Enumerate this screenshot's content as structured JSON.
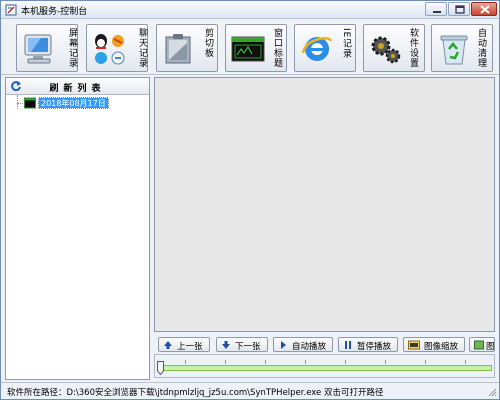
{
  "window": {
    "title": "本机服务-控制台"
  },
  "toolbar": {
    "buttons": [
      {
        "label": "屏幕记录",
        "icon": "monitor-icon"
      },
      {
        "label": "聊天记录",
        "icon": "chat-icon"
      },
      {
        "label": "剪切板",
        "icon": "clipboard-icon"
      },
      {
        "label": "窗口标题",
        "icon": "window-icon"
      },
      {
        "label": "IE记录",
        "icon": "ie-icon"
      },
      {
        "label": "软件设置",
        "icon": "gear-icon"
      },
      {
        "label": "自动清理",
        "icon": "recycle-bin-icon"
      }
    ]
  },
  "left_panel": {
    "refresh_label": "刷新列表",
    "tree": [
      {
        "label": "2018年08月17日"
      }
    ]
  },
  "playback": {
    "prev": "上一张",
    "next": "下一张",
    "auto_play": "自动播放",
    "pause": "暂停播放",
    "zoom": "图像缩放",
    "partial": "图"
  },
  "status": {
    "text": "软件所在路径：D:\\360安全浏览器下载\\jtdnpmlzljq_jz5u.com\\SynTPHelper.exe 双击可打开路径"
  },
  "colors": {
    "title_bar": "#dde6f3",
    "selection": "#3399ff",
    "viewer_bg": "#e8e8e8",
    "slider_fill": "#c8f2a8"
  }
}
